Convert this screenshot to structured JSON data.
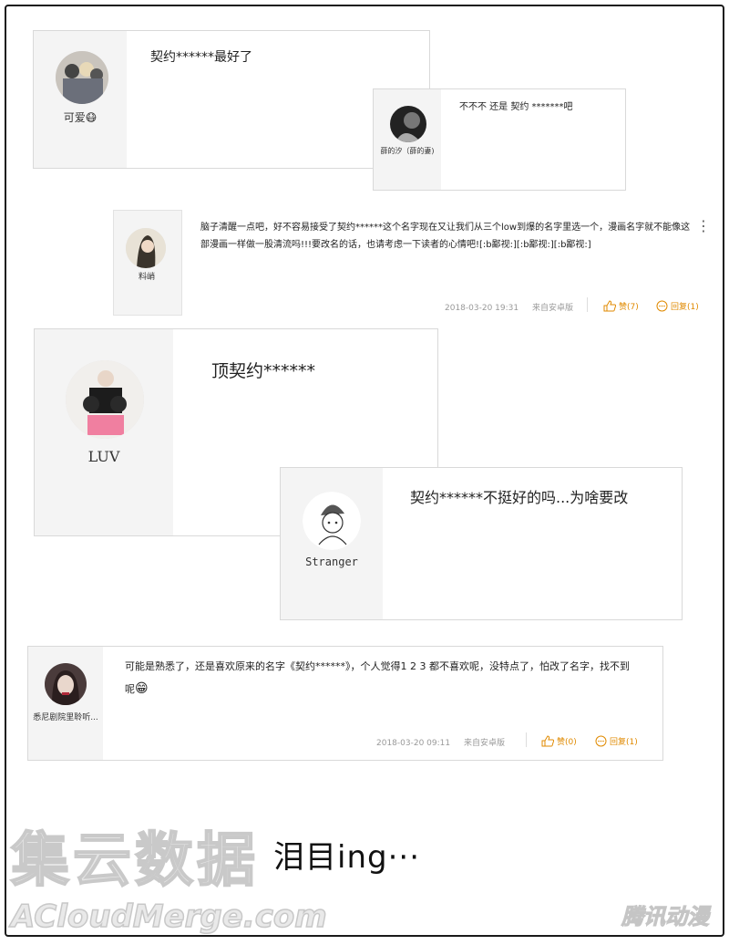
{
  "comments": [
    {
      "user": "可爱😷",
      "text": "契约******最好了"
    },
    {
      "user": "薛的汐（薛的妻)",
      "text": "不不不 还是 契约 *******吧"
    },
    {
      "user": "料峭",
      "text": "脑子清醒一点吧，好不容易接受了契约******这个名字现在又让我们从三个low到爆的名字里选一个，漫画名字就不能像这部漫画一样做一股清流吗!!!要改名的话，也请考虑一下读者的心情吧![:b鄙视:][:b鄙视:][:b鄙视:]",
      "date": "2018-03-20 19:31",
      "source": "来自安卓版",
      "like_label": "赞(7)",
      "reply_label": "回复(1)",
      "menu_glyph": "⋮"
    },
    {
      "user": "LUV",
      "text": "顶契约******"
    },
    {
      "user": "Stranger",
      "text": "契约******不挺好的吗...为啥要改"
    },
    {
      "user": "悉尼剧院里聆听...",
      "text": "可能是熟悉了，还是喜欢原来的名字《契约******》，个人觉得1 2 3 都不喜欢呢，没特点了，怕改了名字，找不到呢",
      "emoji": "😁",
      "date": "2018-03-20 09:11",
      "source": "来自安卓版",
      "like_label": "赞(0)",
      "reply_label": "回复(1)"
    }
  ],
  "caption": "泪目ing···",
  "watermark": {
    "cn": "集云数据",
    "en": "ACloudMerge.com",
    "right": "腾讯动漫"
  }
}
